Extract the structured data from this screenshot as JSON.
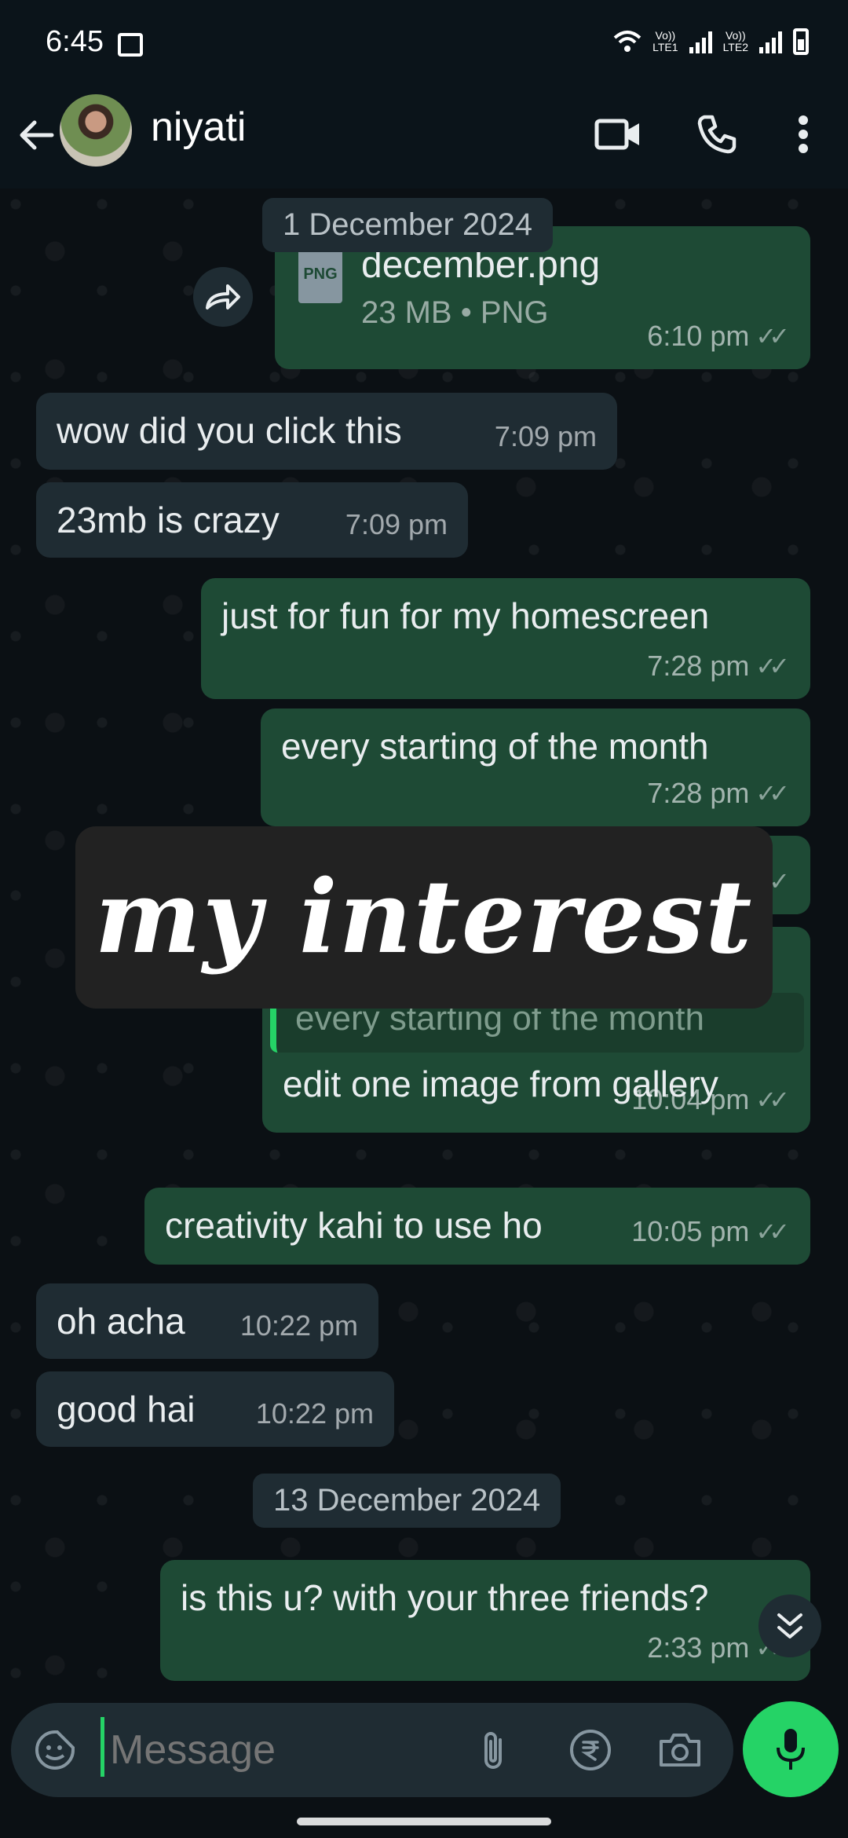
{
  "status": {
    "time": "6:45",
    "sim1": "LTE1",
    "sim2": "LTE2",
    "volte": "Vo))"
  },
  "header": {
    "name": "niyati"
  },
  "messages": {
    "date1": "1 December 2024",
    "file": {
      "name": "december.png",
      "meta": "23 MB • PNG",
      "time": "6:10 pm",
      "badge": "PNG"
    },
    "m1": {
      "text": "wow did you click this",
      "time": "7:09 pm"
    },
    "m2": {
      "text": "23mb is crazy",
      "time": "7:09 pm"
    },
    "m3": {
      "text": "just for fun for my homescreen",
      "time": "7:28 pm"
    },
    "m4": {
      "text": "every starting of the month",
      "time": "7:28 pm"
    },
    "quote": "every starting of the month",
    "m5": {
      "text": "edit one image from gallery",
      "time": "10:04 pm"
    },
    "m6": {
      "text": "creativity kahi to use ho",
      "time": "10:05 pm"
    },
    "m7": {
      "text": "oh acha",
      "time": "10:22 pm"
    },
    "m8": {
      "text": "good hai",
      "time": "10:22 pm"
    },
    "date2": "13 December 2024",
    "m9": {
      "text": "is this u? with your three friends?",
      "time": "2:33 pm"
    }
  },
  "overlay": {
    "text": "my interest"
  },
  "composer": {
    "placeholder": "Message"
  },
  "colors": {
    "accent": "#25d366",
    "outgoing": "#1e4a35",
    "incoming": "#1f2c33"
  }
}
